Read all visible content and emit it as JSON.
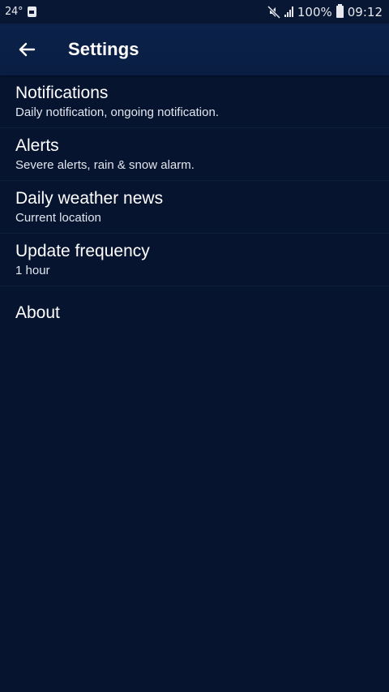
{
  "status_bar": {
    "temperature": "24°",
    "battery_percent": "100%",
    "time": "09:12",
    "icons": [
      "notification-app-icon",
      "mute-icon",
      "signal-icon",
      "battery-icon"
    ]
  },
  "app_bar": {
    "back_icon": "arrow-left-icon",
    "title": "Settings"
  },
  "settings": {
    "items": [
      {
        "title": "Notifications",
        "subtitle": "Daily notification, ongoing notification."
      },
      {
        "title": "Alerts",
        "subtitle": "Severe alerts, rain & snow alarm."
      },
      {
        "title": "Daily weather news",
        "subtitle": "Current location"
      },
      {
        "title": "Update frequency",
        "subtitle": "1 hour"
      },
      {
        "title": "About"
      }
    ]
  },
  "colors": {
    "background": "#061430",
    "app_bar": "#0a1e43",
    "divider": "#0e1f3c",
    "text": "#ffffff"
  }
}
